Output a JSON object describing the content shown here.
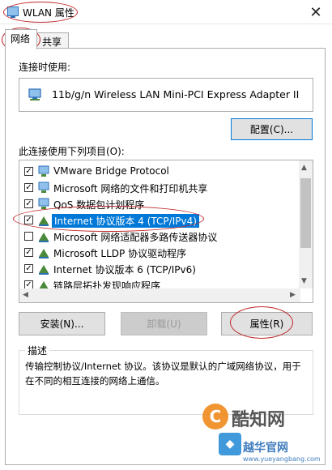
{
  "window": {
    "title": "WLAN 属性",
    "close_label": "✕"
  },
  "tabs": [
    {
      "label": "网络",
      "active": true
    },
    {
      "label": "共享",
      "active": false
    }
  ],
  "connect_using_label": "连接时使用:",
  "adapter_name": "11b/g/n  Wireless LAN Mini-PCI Express Adapter II",
  "configure_button": "配置(C)...",
  "items_label": "此连接使用下列项目(O):",
  "items": [
    {
      "label": "VMware Bridge Protocol",
      "checked": true
    },
    {
      "label": "Microsoft 网络的文件和打印机共享",
      "checked": true
    },
    {
      "label": "QoS 数据包计划程序",
      "checked": true
    },
    {
      "label": "Internet 协议版本 4 (TCP/IPv4)",
      "checked": true,
      "selected": true
    },
    {
      "label": "Microsoft 网络适配器多路传送器协议",
      "checked": false
    },
    {
      "label": "Microsoft LLDP 协议驱动程序",
      "checked": true
    },
    {
      "label": "Internet 协议版本 6 (TCP/IPv6)",
      "checked": true
    },
    {
      "label": "链路层拓扑发现响应程序",
      "checked": true
    }
  ],
  "buttons": {
    "install": "安装(N)...",
    "uninstall": "卸载(U)",
    "properties": "属性(R)"
  },
  "description": {
    "title": "描述",
    "text": "传输控制协议/Internet 协议。该协议是默认的广域网络协议，用于在不同的相互连接的网络上通信。"
  },
  "watermark": {
    "brand": "酷知网",
    "site": "越华官网",
    "url": "www.yueyangbang.com"
  },
  "colors": {
    "accent": "#0078d7",
    "annotation_ring": "#c0282a"
  }
}
